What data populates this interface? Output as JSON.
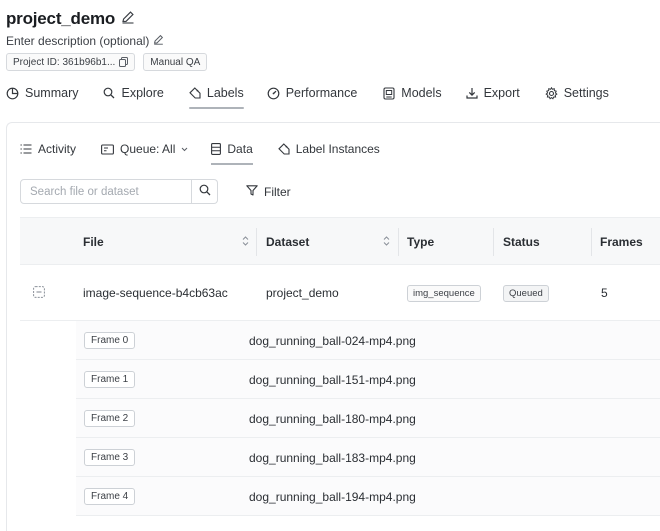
{
  "project": {
    "title": "project_demo",
    "description": "Enter description (optional)",
    "id_chip": "Project ID: 361b96b1...",
    "qa_chip": "Manual QA"
  },
  "tabs": [
    {
      "label": "Summary",
      "icon": "summary-icon"
    },
    {
      "label": "Explore",
      "icon": "search-icon"
    },
    {
      "label": "Labels",
      "icon": "tag-icon",
      "active": true
    },
    {
      "label": "Performance",
      "icon": "gauge-icon"
    },
    {
      "label": "Models",
      "icon": "model-icon"
    },
    {
      "label": "Export",
      "icon": "download-icon"
    },
    {
      "label": "Settings",
      "icon": "gear-icon"
    }
  ],
  "subtabs": [
    {
      "label": "Activity",
      "icon": "list-icon"
    },
    {
      "label": "Queue: All",
      "icon": "queue-icon"
    },
    {
      "label": "Data",
      "icon": "database-icon",
      "active": true
    },
    {
      "label": "Label Instances",
      "icon": "tag-icon"
    }
  ],
  "search": {
    "placeholder": "Search file or dataset"
  },
  "filter_label": "Filter",
  "table": {
    "headers": {
      "file": "File",
      "dataset": "Dataset",
      "type": "Type",
      "status": "Status",
      "frames": "Frames"
    },
    "row": {
      "file": "image-sequence-b4cb63ac",
      "dataset": "project_demo",
      "type": "img_sequence",
      "status": "Queued",
      "frames": "5"
    },
    "frames": [
      {
        "label": "Frame 0",
        "file": "dog_running_ball-024-mp4.png"
      },
      {
        "label": "Frame 1",
        "file": "dog_running_ball-151-mp4.png"
      },
      {
        "label": "Frame 2",
        "file": "dog_running_ball-180-mp4.png"
      },
      {
        "label": "Frame 3",
        "file": "dog_running_ball-183-mp4.png"
      },
      {
        "label": "Frame 4",
        "file": "dog_running_ball-194-mp4.png"
      }
    ]
  }
}
